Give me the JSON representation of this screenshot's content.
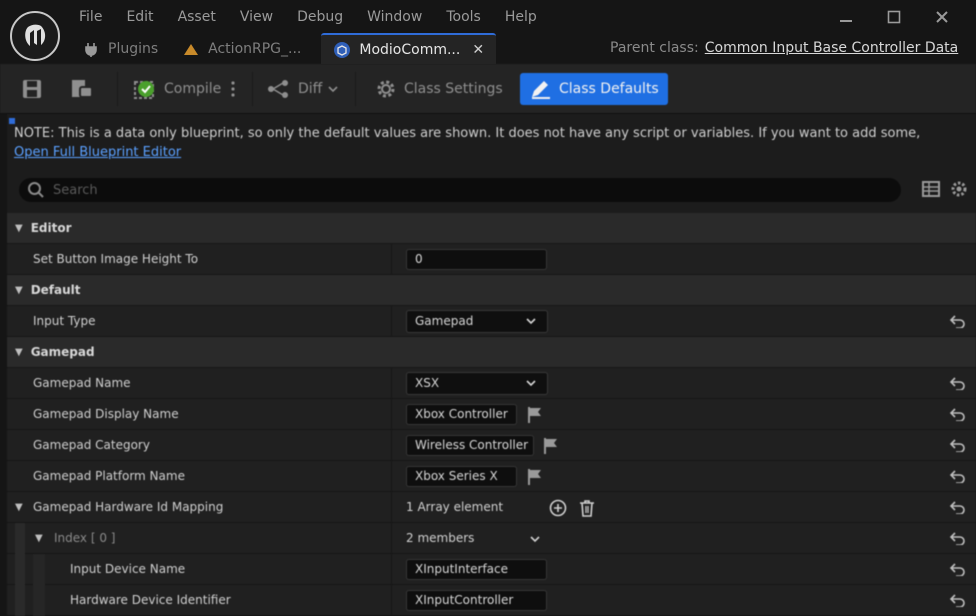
{
  "menu": [
    "File",
    "Edit",
    "Asset",
    "View",
    "Debug",
    "Window",
    "Tools",
    "Help"
  ],
  "tabs": [
    {
      "label": "Plugins"
    },
    {
      "label": "ActionRPG_..."
    },
    {
      "label": "ModioComm...",
      "active": true
    }
  ],
  "parent_class": {
    "label": "Parent class:",
    "value": "Common Input Base Controller Data"
  },
  "toolbar": {
    "compile_label": "Compile",
    "diff_label": "Diff",
    "class_settings_label": "Class Settings",
    "class_defaults_label": "Class Defaults"
  },
  "note": {
    "text": "NOTE: This is a data only blueprint, so only the default values are shown.  It does not have any script or variables.  If you want to add some,",
    "link": "Open Full Blueprint Editor"
  },
  "search": {
    "placeholder": "Search"
  },
  "categories": {
    "editor": "Editor",
    "default": "Default",
    "gamepad": "Gamepad"
  },
  "properties": {
    "set_button_image_height": {
      "name": "Set Button Image Height To",
      "value": "0"
    },
    "input_type": {
      "name": "Input Type",
      "value": "Gamepad"
    },
    "gamepad_name": {
      "name": "Gamepad Name",
      "value": "XSX"
    },
    "gamepad_display_name": {
      "name": "Gamepad Display Name",
      "value": "Xbox Controller"
    },
    "gamepad_category": {
      "name": "Gamepad Category",
      "value": "Wireless Controller"
    },
    "gamepad_platform_name": {
      "name": "Gamepad Platform Name",
      "value": "Xbox Series X"
    },
    "hardware_id_mapping": {
      "name": "Gamepad Hardware Id Mapping",
      "value": "1 Array element"
    },
    "index0": {
      "name": "Index [ 0 ]",
      "value": "2 members"
    },
    "input_device_name": {
      "name": "Input Device Name",
      "value": "XInputInterface"
    },
    "hardware_device_identifier": {
      "name": "Hardware Device Identifier",
      "value": "XInputController"
    }
  },
  "colors": {
    "accent": "#1f6fe3",
    "panel": "#1c1c1c",
    "category": "#2a2a2a"
  }
}
